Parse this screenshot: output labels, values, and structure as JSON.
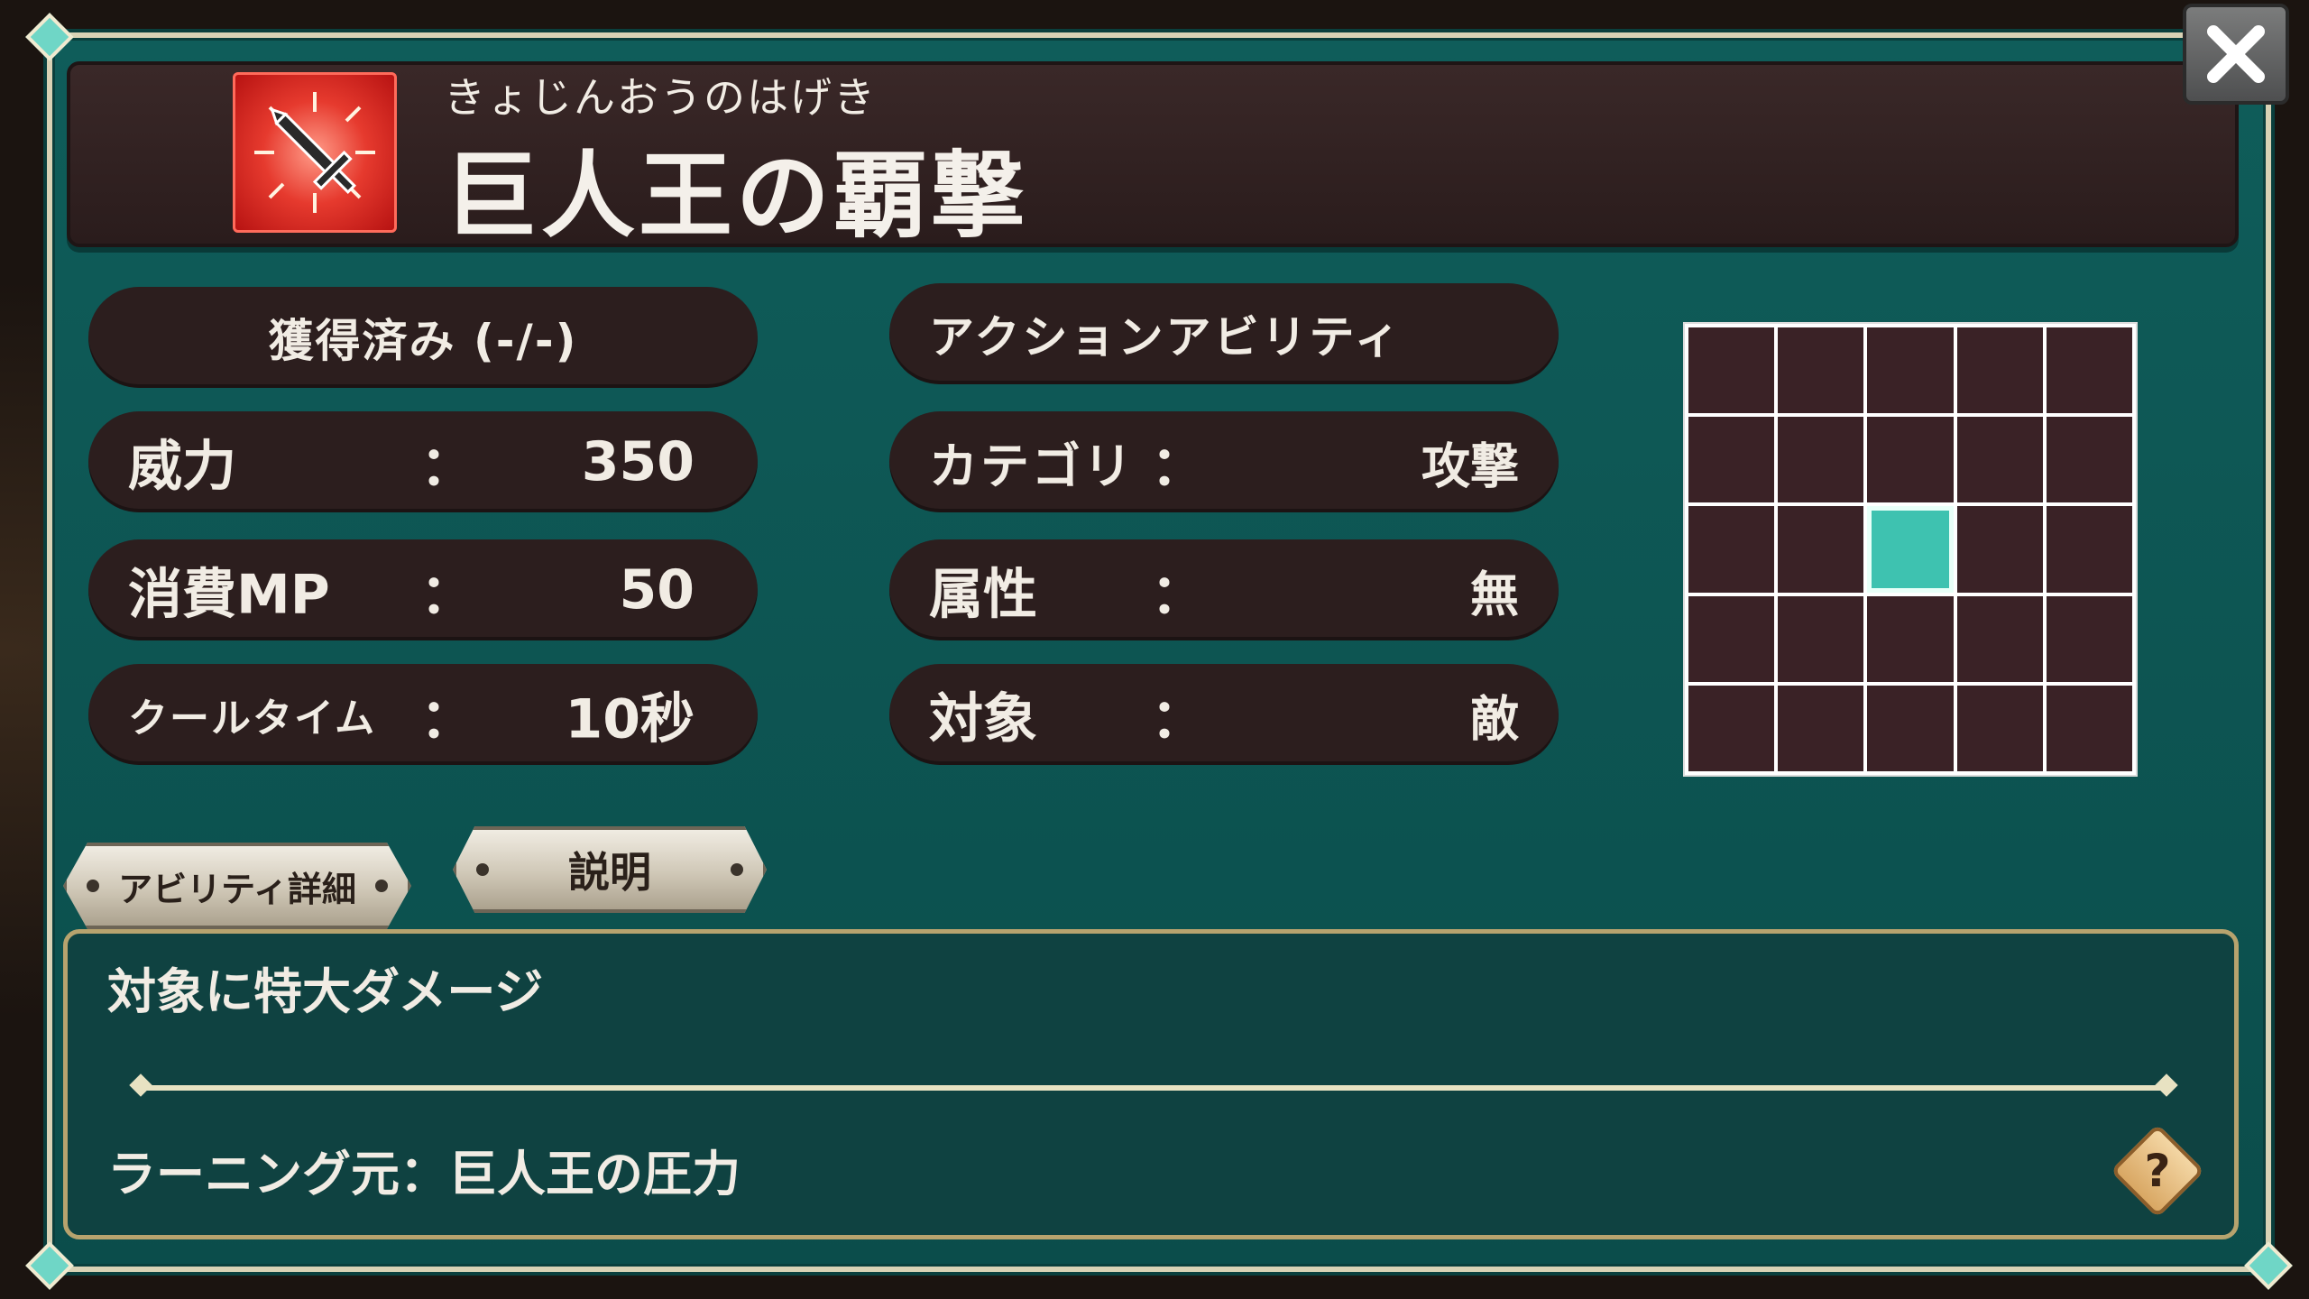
{
  "skill": {
    "ruby": "きょじんおうのはげき",
    "name": "巨人王の覇撃",
    "icon": "sword-burst-icon",
    "icon_color": "#e63a2e"
  },
  "status": {
    "acquired": "獲得済み (-/-)",
    "type": "アクションアビリティ"
  },
  "stats_left": [
    {
      "label": "威力",
      "colon": "：",
      "value": "350"
    },
    {
      "label": "消費MP",
      "colon": "：",
      "value": "50"
    },
    {
      "label": "クールタイム",
      "colon": "：",
      "value": "10秒"
    }
  ],
  "stats_right": [
    {
      "label": "カテゴリ",
      "colon": "：",
      "value": "攻撃"
    },
    {
      "label": "属性",
      "colon": "：",
      "value": "無"
    },
    {
      "label": "対象",
      "colon": "：",
      "value": "敵"
    }
  ],
  "range_grid": {
    "rows": 5,
    "cols": 5,
    "active_cells": [
      [
        2,
        2
      ]
    ],
    "active_color": "#3ec2b0"
  },
  "buttons": {
    "ability_detail": "アビリティ詳細",
    "description": "説明",
    "help": "?",
    "close": "close-icon"
  },
  "description": {
    "text": "対象に特大ダメージ",
    "learning_source": "ラーニング元：巨人王の圧力"
  }
}
